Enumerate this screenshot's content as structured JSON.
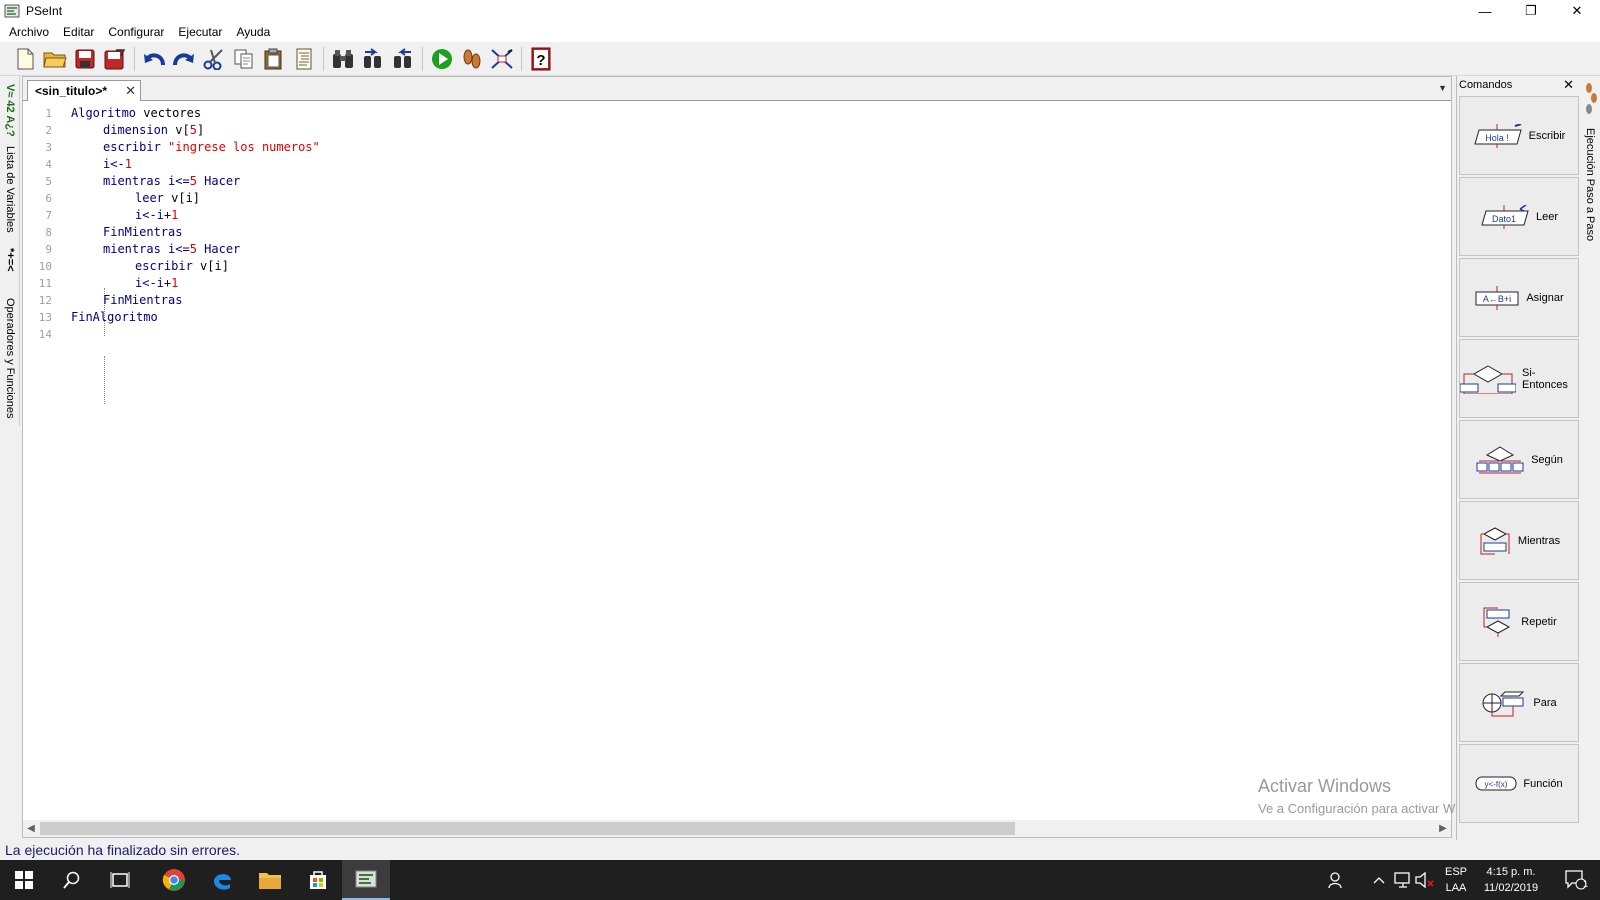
{
  "window": {
    "title": "PSeInt",
    "minimize": "—",
    "restore": "❐",
    "close": "✕"
  },
  "menu": [
    "Archivo",
    "Editar",
    "Configurar",
    "Ejecutar",
    "Ayuda"
  ],
  "left_panel": {
    "variables_label": "Lista de Variables",
    "variables_glyphs": "V≈ 42 A¿?",
    "operators_label": "Operadores y Funciones",
    "operators_glyphs": "*+=<"
  },
  "editor": {
    "tab_label": "<sin_titulo>*",
    "tab_close": "✕",
    "lines": [
      {
        "n": "1"
      },
      {
        "n": "2"
      },
      {
        "n": "3"
      },
      {
        "n": "4"
      },
      {
        "n": "5"
      },
      {
        "n": "6"
      },
      {
        "n": "7"
      },
      {
        "n": "8"
      },
      {
        "n": "9"
      },
      {
        "n": "10"
      },
      {
        "n": "11"
      },
      {
        "n": "12"
      },
      {
        "n": "13"
      },
      {
        "n": "14"
      }
    ],
    "code": {
      "l1_kw": "Algoritmo",
      "l1_rest": " vectores",
      "l2_kw": "dimension",
      "l2_a": " v[",
      "l2_num": "5",
      "l2_b": "]",
      "l3_kw": "escribir",
      "l3_str": " \"ingrese los numeros\"",
      "l4_a": "i<-",
      "l4_num": "1",
      "l5_kw": "mientras",
      "l5_a": " i<=",
      "l5_num": "5",
      "l5_kw2": " Hacer",
      "l6_kw": "leer",
      "l6_a": " v[i]",
      "l7_a": "i<-i+",
      "l7_num": "1",
      "l8_kw": "FinMientras",
      "l9_kw": "mientras",
      "l9_a": " i<=",
      "l9_num": "5",
      "l9_kw2": " Hacer",
      "l10_kw": "escribir",
      "l10_a": " v[i]",
      "l11_a": "i<-i+",
      "l11_num": "1",
      "l12_kw": "FinMientras",
      "l13_kw": "FinAlgoritmo"
    }
  },
  "watermark": {
    "line1": "Activar Windows",
    "line2": "Ve a Configuración para activar Windows."
  },
  "commands": {
    "header": "Comandos",
    "close": "✕",
    "items": [
      {
        "label": "Escribir",
        "icon_text": "Hola !"
      },
      {
        "label": "Leer",
        "icon_text": "Dato1"
      },
      {
        "label": "Asignar",
        "icon_text": "A←B+i"
      },
      {
        "label": "Si-Entonces"
      },
      {
        "label": "Según"
      },
      {
        "label": "Mientras"
      },
      {
        "label": "Repetir"
      },
      {
        "label": "Para"
      },
      {
        "label": "Función",
        "icon_text": "y<-f(x)"
      }
    ]
  },
  "right_panel": {
    "label": "Ejecución Paso a Paso"
  },
  "status": {
    "message": "La ejecución ha finalizado sin errores."
  },
  "taskbar": {
    "lang1": "ESP",
    "lang2": "LAA",
    "time": "4:15 p. m.",
    "date": "11/02/2019",
    "notifications": "1"
  }
}
